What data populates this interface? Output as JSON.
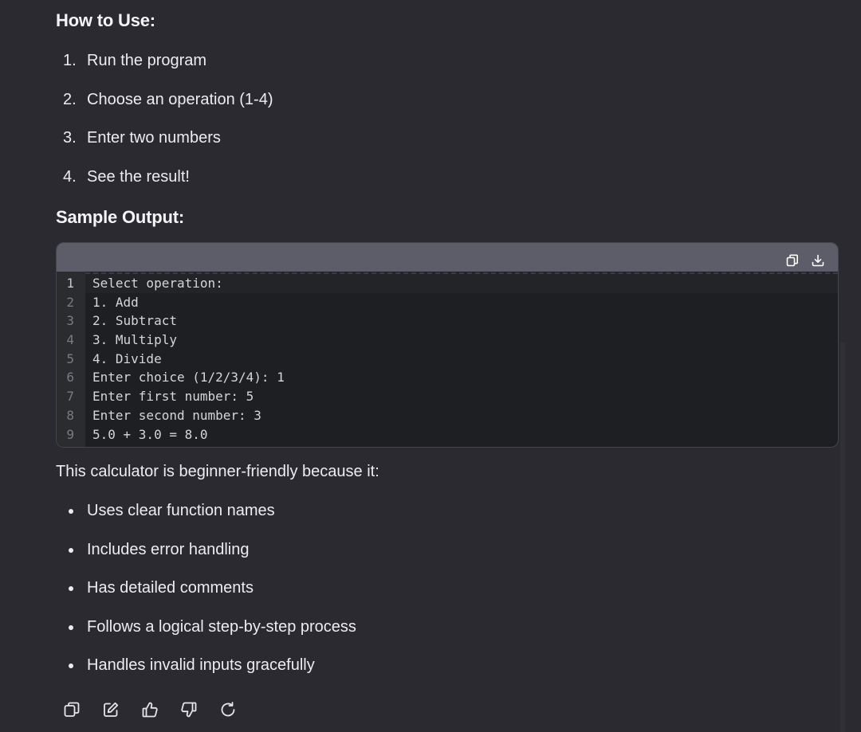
{
  "sections": {
    "how_to_use_heading": "How to Use:",
    "steps": [
      {
        "num": "1.",
        "text": "Run the program"
      },
      {
        "num": "2.",
        "text": "Choose an operation (1-4)"
      },
      {
        "num": "3.",
        "text": "Enter two numbers"
      },
      {
        "num": "4.",
        "text": "See the result!"
      }
    ],
    "sample_output_heading": "Sample Output:",
    "code": {
      "lines": [
        {
          "n": "1",
          "text": "Select operation:"
        },
        {
          "n": "2",
          "text": "1. Add"
        },
        {
          "n": "3",
          "text": "2. Subtract"
        },
        {
          "n": "4",
          "text": "3. Multiply"
        },
        {
          "n": "5",
          "text": "4. Divide"
        },
        {
          "n": "6",
          "text": "Enter choice (1/2/3/4): 1"
        },
        {
          "n": "7",
          "text": "Enter first number: 5"
        },
        {
          "n": "8",
          "text": "Enter second number: 3"
        },
        {
          "n": "9",
          "text": "5.0 + 3.0 = 8.0"
        }
      ],
      "actions": [
        "copy-icon",
        "download-icon"
      ]
    },
    "summary": "This calculator is beginner-friendly because it:",
    "bullets": [
      "Uses clear function names",
      "Includes error handling",
      "Has detailed comments",
      "Follows a logical step-by-step process",
      "Handles invalid inputs gracefully"
    ]
  },
  "message_actions": [
    "copy-icon",
    "edit-icon",
    "thumbs-up-icon",
    "thumbs-down-icon",
    "regenerate-icon"
  ],
  "colors": {
    "background": "#2a2a30",
    "text": "#ececf1",
    "code_bg": "#1e1f22",
    "code_header": "#5d5d69"
  }
}
